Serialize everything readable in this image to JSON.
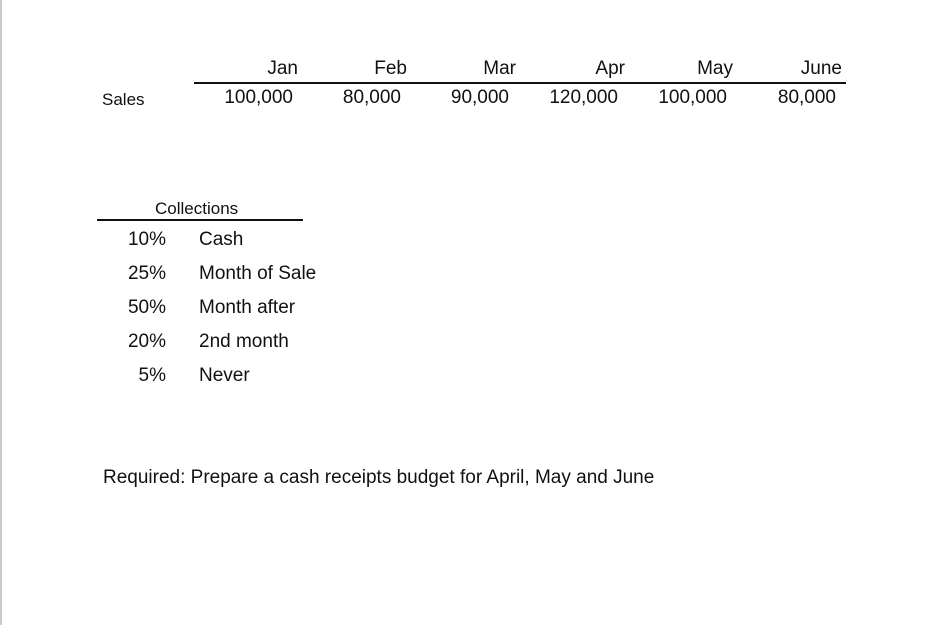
{
  "sales": {
    "label": "Sales",
    "months": [
      "Jan",
      "Feb",
      "Mar",
      "Apr",
      "May",
      "June"
    ],
    "values": [
      "100,000",
      "80,000",
      "90,000",
      "120,000",
      "100,000",
      "80,000"
    ]
  },
  "collections": {
    "title": "Collections",
    "rows": [
      {
        "pct": "10%",
        "desc": "Cash"
      },
      {
        "pct": "25%",
        "desc": "Month of Sale"
      },
      {
        "pct": "50%",
        "desc": "Month after"
      },
      {
        "pct": "20%",
        "desc": "2nd month"
      },
      {
        "pct": "5%",
        "desc": "Never"
      }
    ]
  },
  "required": "Required: Prepare a cash receipts budget for April, May and June"
}
